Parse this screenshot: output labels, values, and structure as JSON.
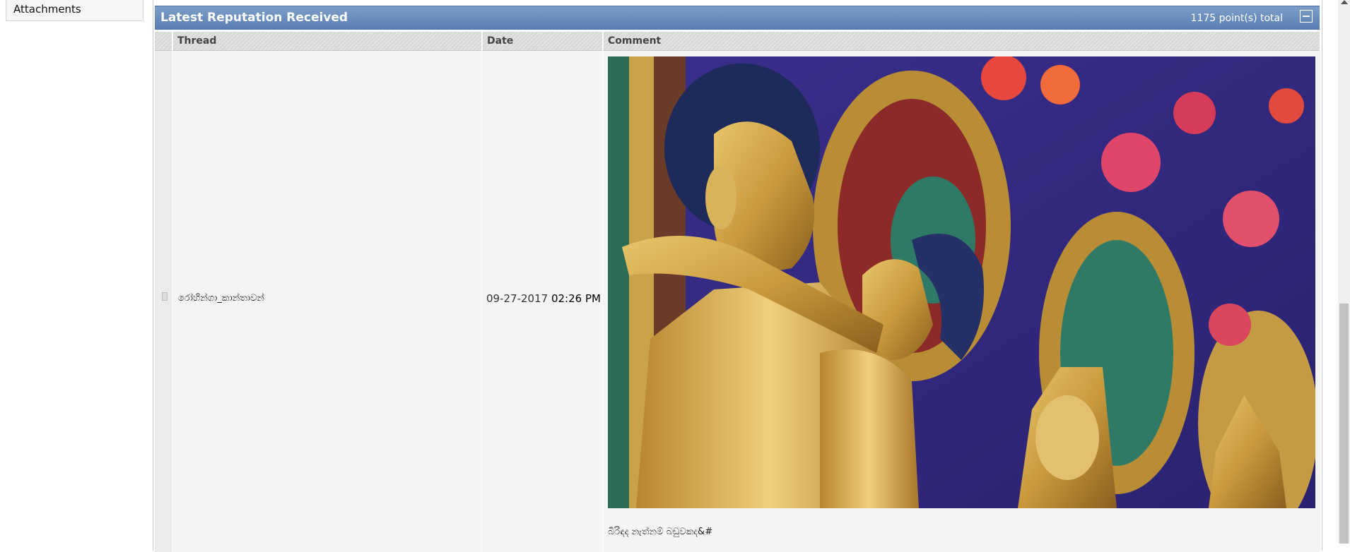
{
  "sidebar": {
    "attachments_label": "Attachments"
  },
  "panel": {
    "title": "Latest Reputation Received",
    "total": "1175 point(s) total",
    "collapse_icon": "collapse-icon"
  },
  "columns": {
    "thread": "Thread",
    "date": "Date",
    "comment": "Comment"
  },
  "rows": [
    {
      "thread": "රෝහින්ගා_කාන්තාවන්",
      "date": "09-27-2017",
      "time": "02:26 PM",
      "comment_image": "golden-buddha-statue-image",
      "comment_text": "බිරිඳද නැත්නම් බඩුවකද&#"
    }
  ],
  "colors": {
    "header_blue": "#5a7fb3",
    "cell_bg": "#f4f4f4"
  }
}
